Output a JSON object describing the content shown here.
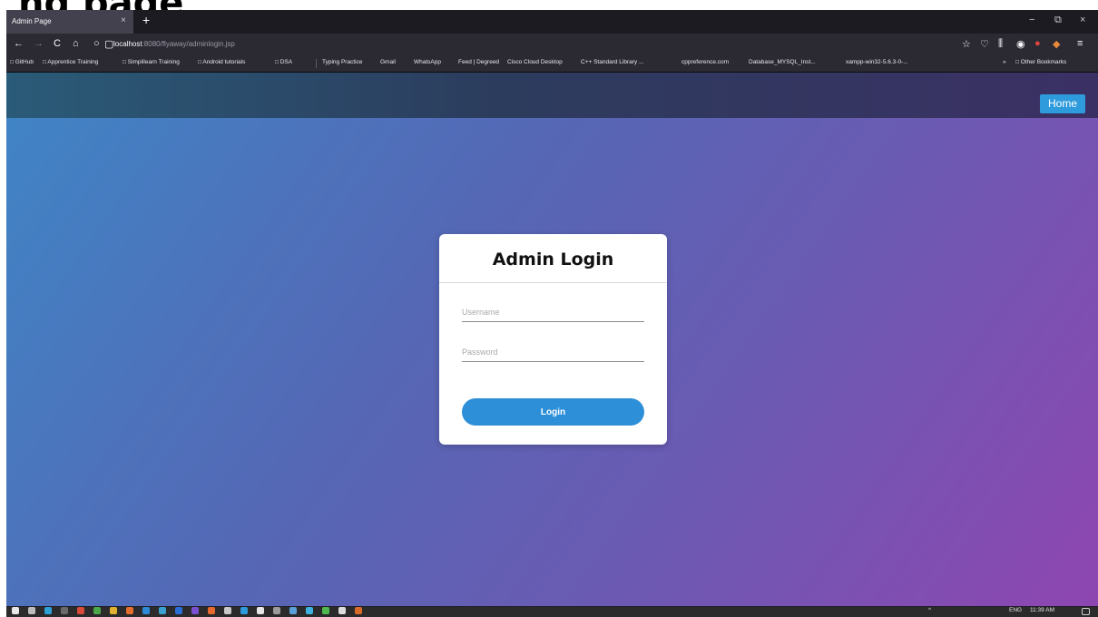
{
  "slide": {
    "title": "ng page"
  },
  "browser": {
    "tab": {
      "title": "Admin Page",
      "close": "×"
    },
    "new_tab": "+",
    "window_controls": {
      "minimize": "−",
      "restore": "⧉",
      "close": "×"
    },
    "nav": {
      "back": "←",
      "forward": "→",
      "reload": "C",
      "home": "⌂",
      "tracking": "○",
      "page": "▢"
    },
    "url": {
      "host": "localhost",
      "path": ":8080/flyaway/adminlogin.jsp"
    },
    "toolbar_right": {
      "star": "☆",
      "pocket": "♡",
      "library": "⫼",
      "ext1": "◉",
      "ext2": "●",
      "ext3": "◆",
      "menu": "≡"
    },
    "bookmarks": [
      "□ GitHub",
      "□ Apprentice Training",
      "□ Simplilearn Training",
      "□ Android tutorials",
      "□ DSA",
      "Typing Practice",
      "Gmail",
      "WhatsApp",
      "Feed | Degreed",
      "Cisco Cloud Desktop",
      "C++ Standard Library ...",
      "cppreference.com",
      "Database_MYSQL_Inst...",
      "xampp-win32-5.6.3-0-..."
    ],
    "bookmarks_overflow": "»",
    "other_bookmarks": "□ Other Bookmarks"
  },
  "site": {
    "home_button": "Home",
    "login_card": {
      "title": "Admin Login",
      "username_placeholder": "Username",
      "password_placeholder": "Password",
      "login_button": "Login"
    }
  },
  "taskbar": {
    "tray_text": "ENG",
    "time": "11:39 AM",
    "tray_arrow": "^"
  },
  "colors": {
    "home_button": "#2e9bdc",
    "login_button": "#2d8fd8",
    "gradient_start": "#3f86c6",
    "gradient_end": "#8e46b0"
  }
}
